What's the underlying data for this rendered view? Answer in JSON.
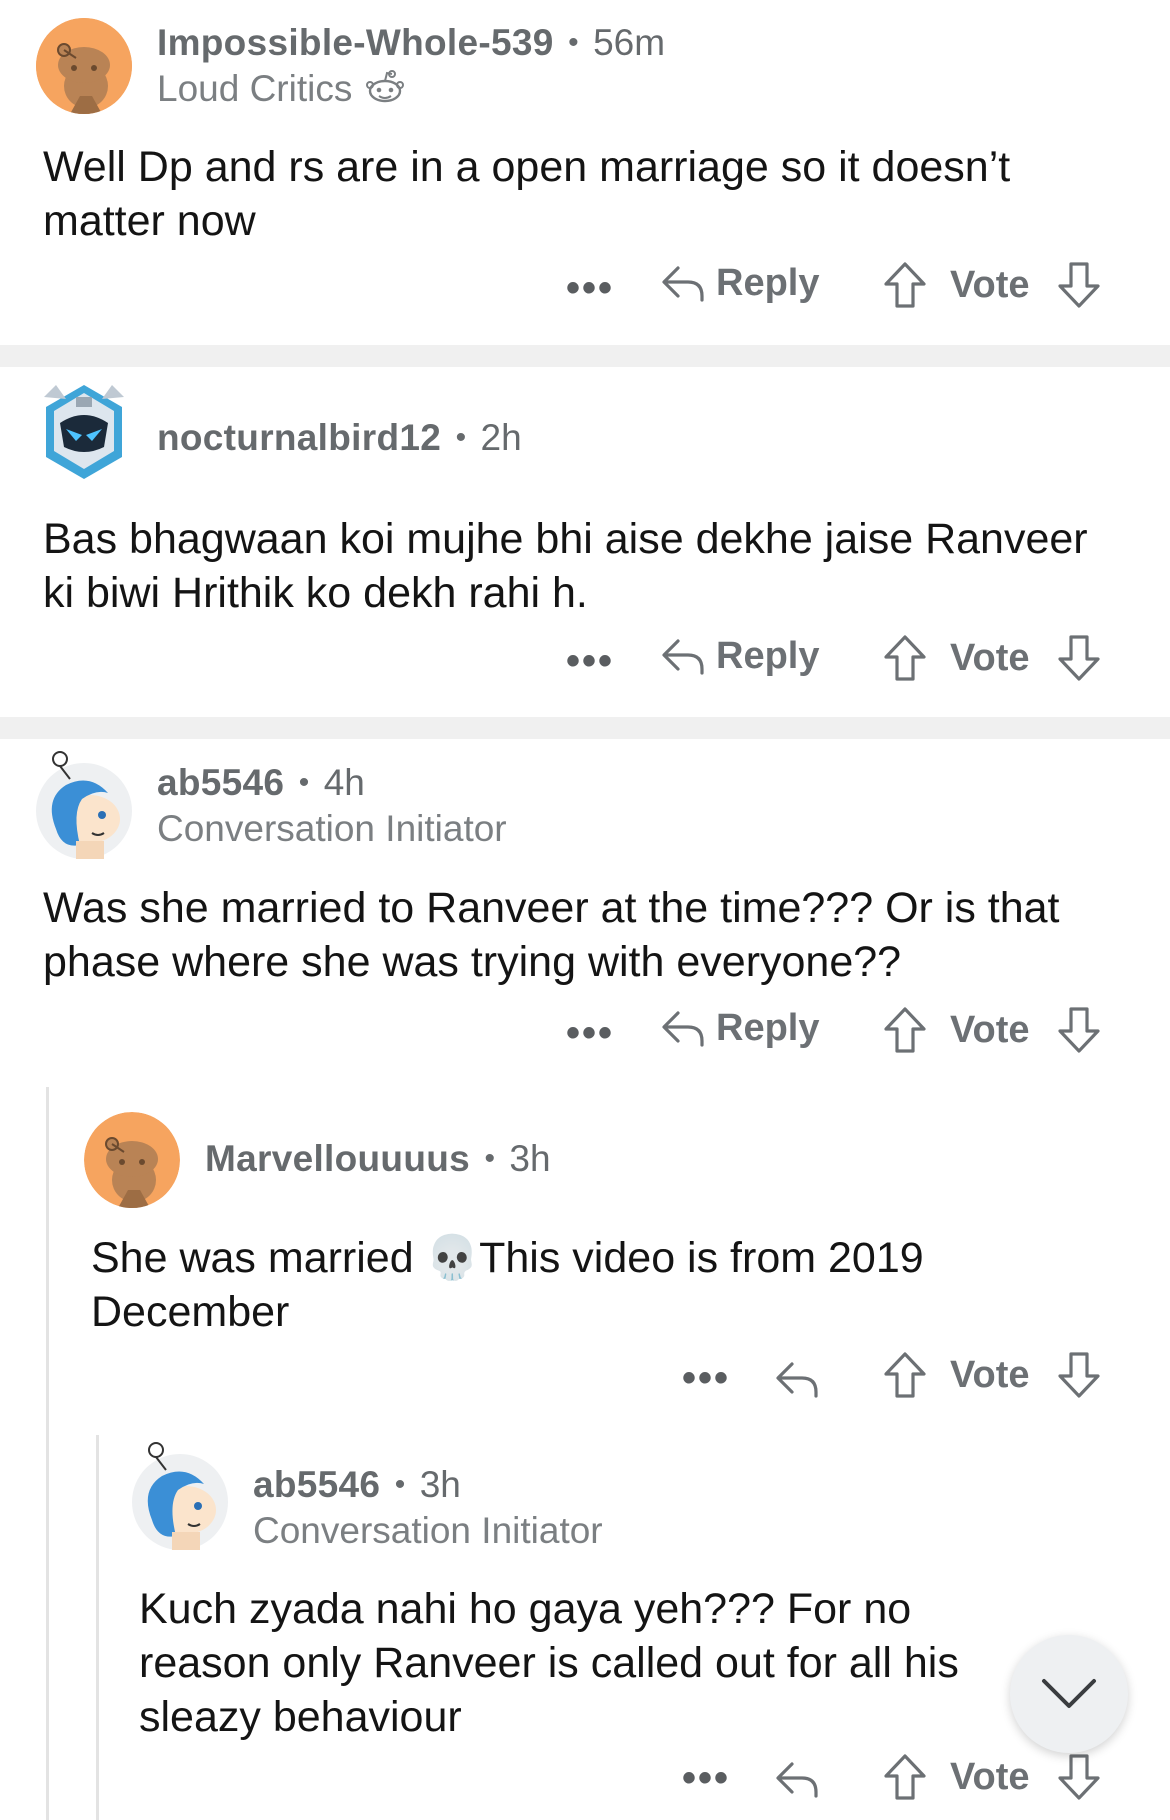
{
  "comments": [
    {
      "username": "Impossible-Whole-539",
      "time": "56m",
      "flair": "Loud Critics",
      "flair_icon": "snoo-face-icon",
      "body": "Well Dp and rs are in a open marriage so it doesn’t matter now",
      "reply_label": "Reply",
      "vote_label": "Vote",
      "avatar": "orange-snoo-avatar"
    },
    {
      "username": "nocturnalbird12",
      "time": "2h",
      "body": "Bas bhagwaan koi mujhe bhi aise dekhe jaise Ranveer ki biwi Hrithik ko dekh rahi h.",
      "reply_label": "Reply",
      "vote_label": "Vote",
      "avatar": "robot-helmet-avatar"
    },
    {
      "username": "ab5546",
      "time": "4h",
      "flair": "Conversation Initiator",
      "body": "Was she married to Ranveer at the time??? Or is that phase where she was trying with everyone??",
      "reply_label": "Reply",
      "vote_label": "Vote",
      "avatar": "blue-hair-snoo-avatar"
    },
    {
      "username": "Marvellouuuus",
      "time": "3h",
      "body_before": "She was married ",
      "emoji": "💀",
      "body_after": "This video is from 2019 December",
      "vote_label": "Vote",
      "avatar": "orange-snoo-avatar"
    },
    {
      "username": "ab5546",
      "time": "3h",
      "flair": "Conversation Initiator",
      "body": "Kuch zyada nahi ho gaya yeh??? For no reason only Ranveer is called out for all his sleazy behaviour",
      "vote_label": "Vote",
      "avatar": "blue-hair-snoo-avatar"
    }
  ],
  "more_label": "•••",
  "dot": "•",
  "colors": {
    "meta_gray": "#666a6d",
    "snoo_orange": "#f5a25c",
    "divider": "#f0f0f0"
  },
  "scroll_button_icon": "chevron-down-icon"
}
